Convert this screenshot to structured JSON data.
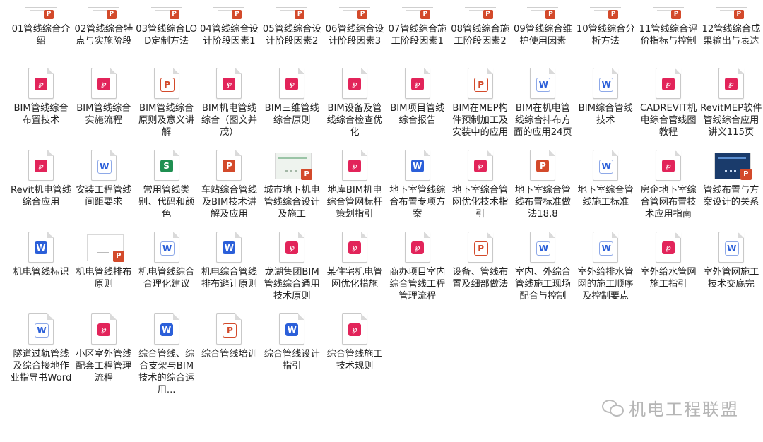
{
  "files": [
    {
      "label": "01管线综合介绍",
      "icon": "thumb"
    },
    {
      "label": "02管线综合特点与实施阶段",
      "icon": "thumb"
    },
    {
      "label": "03管线综合LOD定制方法",
      "icon": "thumb"
    },
    {
      "label": "04管线综合设计阶段因素1",
      "icon": "thumb"
    },
    {
      "label": "05管线综合设计阶段因素2",
      "icon": "thumb"
    },
    {
      "label": "06管线综合设计阶段因素3",
      "icon": "thumb"
    },
    {
      "label": "07管线综合施工阶段因素1",
      "icon": "thumb"
    },
    {
      "label": "08管线综合施工阶段因素2",
      "icon": "thumb"
    },
    {
      "label": "09管线综合维护使用因素",
      "icon": "thumb"
    },
    {
      "label": "10管线综合分析方法",
      "icon": "thumb"
    },
    {
      "label": "11管线综合评价指标与控制",
      "icon": "thumb"
    },
    {
      "label": "12管线综合成果输出与表达",
      "icon": "thumb"
    },
    {
      "label": "BIM管线综合布置技术",
      "icon": "pdf"
    },
    {
      "label": "BIM管线综合实施流程",
      "icon": "pdf"
    },
    {
      "label": "BIM管线综合原则及意义讲解",
      "icon": "pptw"
    },
    {
      "label": "BIM机电管线综合（图文并茂）",
      "icon": "pdf"
    },
    {
      "label": "BIM三维管线综合原则",
      "icon": "pdf"
    },
    {
      "label": "BIM设备及管线综合检查优化",
      "icon": "pdf"
    },
    {
      "label": "BIM项目管线综合报告",
      "icon": "pdf"
    },
    {
      "label": "BIM在MEP构件预制加工及安装中的应用",
      "icon": "pptw"
    },
    {
      "label": "BIM在机电管线综合排布方面的应用24页",
      "icon": "wordw"
    },
    {
      "label": "BIM综合管线技术",
      "icon": "wordw"
    },
    {
      "label": "CADREVIT机电综合管线图教程",
      "icon": "pdf"
    },
    {
      "label": "RevitMEP软件管线综合应用讲义115页",
      "icon": "pdf"
    },
    {
      "label": "Revit机电管线综合应用",
      "icon": "pdf"
    },
    {
      "label": "安装工程管线间距要求",
      "icon": "wordw"
    },
    {
      "label": "常用管线类别、代码和颜色",
      "icon": "xls"
    },
    {
      "label": "车站综合管线及BIM技术讲解及应用",
      "icon": "ppt"
    },
    {
      "label": "城市地下机电管线综合设计及施工",
      "icon": "img"
    },
    {
      "label": "地库BIM机电综合管网标杆策划指引",
      "icon": "pdf"
    },
    {
      "label": "地下室管线综合布置专项方案",
      "icon": "word"
    },
    {
      "label": "地下室综合管网优化技术指引",
      "icon": "pdf"
    },
    {
      "label": "地下室综合管线布置标准做法18.8",
      "icon": "ppt"
    },
    {
      "label": "地下室综合管线施工标准",
      "icon": "wordw"
    },
    {
      "label": "房企地下室综合管网布置技术应用指南",
      "icon": "pdf"
    },
    {
      "label": "管线布置与方案设计的关系",
      "icon": "imgdark"
    },
    {
      "label": "机电管线标识",
      "icon": "word"
    },
    {
      "label": "机电管线排布原则",
      "icon": "imgdoc"
    },
    {
      "label": "机电管线综合合理化建议",
      "icon": "wordw"
    },
    {
      "label": "机电综合管线排布避让原则",
      "icon": "word"
    },
    {
      "label": "龙湖集团BIM管线综合通用技术原则",
      "icon": "pdf"
    },
    {
      "label": "某住宅机电管网优化措施",
      "icon": "pdf"
    },
    {
      "label": "商办项目室内综合管线工程管理流程",
      "icon": "pdf"
    },
    {
      "label": "设备、管线布置及细部做法",
      "icon": "pptw"
    },
    {
      "label": "室内、外综合管线施工现场配合与控制",
      "icon": "wordw"
    },
    {
      "label": "室外给排水管网的施工顺序及控制要点",
      "icon": "wordw"
    },
    {
      "label": "室外给水管网施工指引",
      "icon": "pdf"
    },
    {
      "label": "室外管网施工技术交底完",
      "icon": "wordw"
    },
    {
      "label": "隧道过轨管线及综合接地作业指导书Word",
      "icon": "wordw"
    },
    {
      "label": "小区室外管线配套工程管理流程",
      "icon": "pdf"
    },
    {
      "label": "综合管线、综合支架与BIM技术的综合运用...",
      "icon": "word"
    },
    {
      "label": "综合管线培训",
      "icon": "pptw"
    },
    {
      "label": "综合管线设计指引",
      "icon": "word"
    },
    {
      "label": "综合管线施工技术规则",
      "icon": "pdf"
    }
  ],
  "glyphs": {
    "pdf": "Ὕ",
    "ppt": "P",
    "word": "W",
    "xls": "S"
  },
  "watermark": {
    "text": "机电工程联盟"
  }
}
